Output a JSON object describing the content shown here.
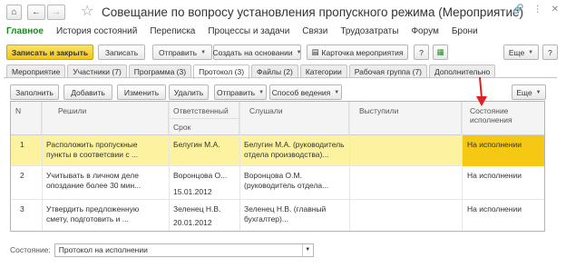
{
  "window": {
    "title": "Совещание по вопросу установления пропускного режима (Мероприятие)",
    "home_icon": "home-icon",
    "back_icon": "arrow-left-icon",
    "forward_icon": "arrow-right-icon",
    "star_icon": "star-icon",
    "link_icon": "link-icon",
    "more_icon": "more-vertical-icon",
    "close_icon": "close-icon"
  },
  "menu": [
    "Главное",
    "История состояний",
    "Переписка",
    "Процессы и задачи",
    "Связи",
    "Трудозатраты",
    "Форум",
    "Брони"
  ],
  "toolbar": {
    "save_close": "Записать и закрыть",
    "save": "Записать",
    "send": "Отправить",
    "create_based": "Создать на основании",
    "event_card": "Карточка мероприятия",
    "more": "Еще",
    "help": "?"
  },
  "tabs": [
    "Мероприятие",
    "Участники (7)",
    "Программа (3)",
    "Протокол (3)",
    "Файлы (2)",
    "Категории",
    "Рабочая группа (7)",
    "Дополнительно"
  ],
  "protocol_toolbar": {
    "fill": "Заполнить",
    "add": "Добавить",
    "edit": "Изменить",
    "delete": "Удалить",
    "send": "Отправить",
    "method": "Способ ведения",
    "more": "Еще"
  },
  "table": {
    "headers": {
      "n": "N",
      "decisions": "Решили",
      "responsible": "Ответственный",
      "deadline": "Срок",
      "heard": "Слушали",
      "spoke": "Выступили",
      "status": "Состояние исполнения"
    },
    "rows": [
      {
        "n": "1",
        "decision_1": "Расположить пропускные",
        "decision_2": "пункты в соответсвии с ...",
        "responsible": "Белугин М.А.",
        "deadline": "",
        "heard_1": "Белугин М.А. (руководитель",
        "heard_2": "отдела производства)...",
        "status": "На исполнении"
      },
      {
        "n": "2",
        "decision_1": "Учитывать в личном деле",
        "decision_2": "опоздание более 30 мин...",
        "responsible": "Воронцова О...",
        "deadline": "15.01.2012",
        "heard_1": "Воронцова О.М.",
        "heard_2": "(руководитель отдела...",
        "status": "На исполнении"
      },
      {
        "n": "3",
        "decision_1": "Утвердить предложенную",
        "decision_2": "смету, подготовить и ...",
        "responsible": "Зеленец Н.В.",
        "deadline": "20.01.2012",
        "heard_1": "Зеленец Н.В. (главный",
        "heard_2": "бухгалтер)...",
        "status": "На исполнении"
      }
    ]
  },
  "footer": {
    "label": "Состояние:",
    "value": "Протокол на исполнении"
  },
  "annotation": {
    "color": "#e02020"
  }
}
